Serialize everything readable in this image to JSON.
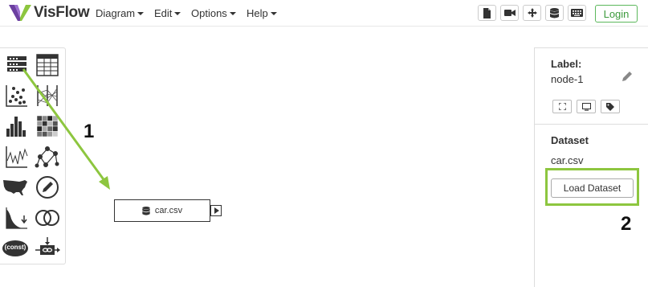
{
  "app": {
    "brand": "VisFlow"
  },
  "navbar": {
    "menus": [
      {
        "label": "Diagram"
      },
      {
        "label": "Edit"
      },
      {
        "label": "Options"
      },
      {
        "label": "Help"
      }
    ],
    "toolbar_icons": [
      "file-icon",
      "video-camera-icon",
      "move-arrows-icon",
      "database-icon",
      "keyboard-icon"
    ],
    "login_label": "Login"
  },
  "node_panel": {
    "node_types": [
      "data-source",
      "table",
      "scatterplot",
      "parallel-coordinates",
      "histogram",
      "heatmap",
      "line-chart",
      "network",
      "map",
      "visual-editor",
      "value-filter",
      "set-operator",
      "constants",
      "linker"
    ],
    "constants_label": "(const)"
  },
  "canvas": {
    "node": {
      "label": "car.csv",
      "icon": "database-icon"
    }
  },
  "option_panel": {
    "label_heading": "Label:",
    "node_label": "node-1",
    "dataset_heading": "Dataset",
    "dataset_file": "car.csv",
    "load_button": "Load Dataset"
  },
  "annotations": {
    "step1": "1",
    "step2": "2"
  },
  "colors": {
    "accent_green": "#8dc63f",
    "logo_purple": "#6b3fa0",
    "login_green": "#5cb85c"
  }
}
